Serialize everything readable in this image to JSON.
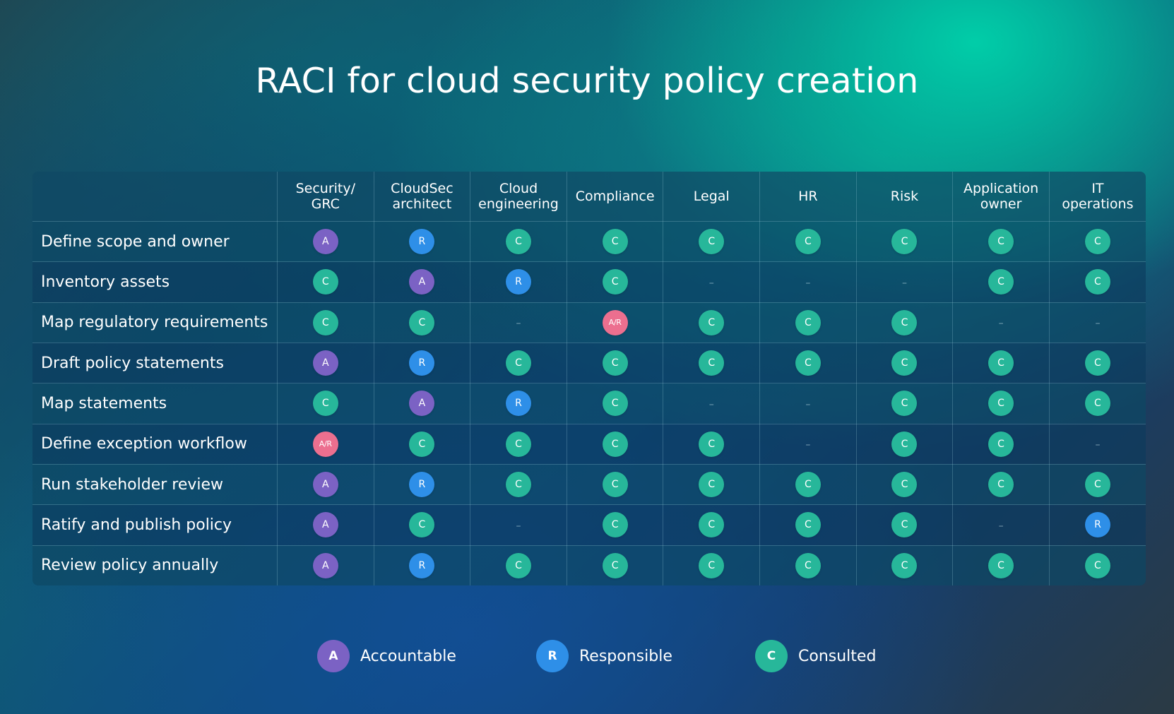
{
  "title": "RACI for cloud security policy creation",
  "colors": {
    "accountable": "#7b62c4",
    "responsible": "#2e8fe8",
    "consulted": "#27b79a",
    "accountable_responsible": "#ec6f8f"
  },
  "columns": [
    "Security/\nGRC",
    "CloudSec\narchitect",
    "Cloud\nengineering",
    "Compliance",
    "Legal",
    "HR",
    "Risk",
    "Application\nowner",
    "IT\noperations"
  ],
  "rows": [
    {
      "activity": "Define scope and owner",
      "cells": [
        "A",
        "R",
        "C",
        "C",
        "C",
        "C",
        "C",
        "C",
        "C"
      ]
    },
    {
      "activity": "Inventory assets",
      "cells": [
        "C",
        "A",
        "R",
        "C",
        "–",
        "–",
        "–",
        "C",
        "C"
      ]
    },
    {
      "activity": "Map regulatory requirements",
      "cells": [
        "C",
        "C",
        "–",
        "A/R",
        "C",
        "C",
        "C",
        "–",
        "–"
      ]
    },
    {
      "activity": "Draft policy statements",
      "cells": [
        "A",
        "R",
        "C",
        "C",
        "C",
        "C",
        "C",
        "C",
        "C"
      ]
    },
    {
      "activity": "Map statements",
      "cells": [
        "C",
        "A",
        "R",
        "C",
        "–",
        "–",
        "C",
        "C",
        "C"
      ]
    },
    {
      "activity": "Define exception workflow",
      "cells": [
        "A/R",
        "C",
        "C",
        "C",
        "C",
        "–",
        "C",
        "C",
        "–"
      ]
    },
    {
      "activity": "Run stakeholder review",
      "cells": [
        "A",
        "R",
        "C",
        "C",
        "C",
        "C",
        "C",
        "C",
        "C"
      ]
    },
    {
      "activity": "Ratify and publish policy",
      "cells": [
        "A",
        "C",
        "–",
        "C",
        "C",
        "C",
        "C",
        "–",
        "R"
      ]
    },
    {
      "activity": "Review policy annually",
      "cells": [
        "A",
        "R",
        "C",
        "C",
        "C",
        "C",
        "C",
        "C",
        "C"
      ]
    }
  ],
  "legend": [
    {
      "letter": "A",
      "label": "Accountable",
      "icon": "accountable-badge-icon"
    },
    {
      "letter": "R",
      "label": "Responsible",
      "icon": "responsible-badge-icon"
    },
    {
      "letter": "C",
      "label": "Consulted",
      "icon": "consulted-badge-icon"
    }
  ]
}
